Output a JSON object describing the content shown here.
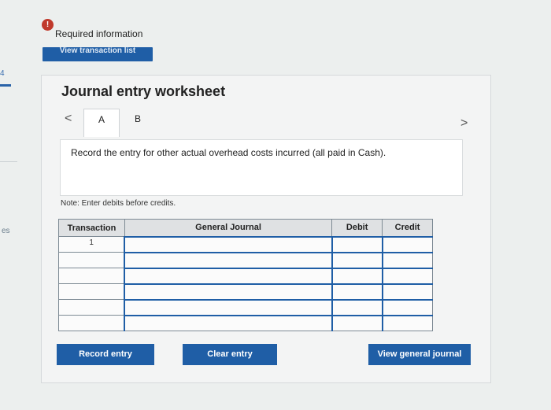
{
  "edge": {
    "number": "4",
    "text": "es"
  },
  "header": {
    "alert_glyph": "!",
    "required_info": "Required information",
    "view_transaction_list": "View transaction list"
  },
  "worksheet": {
    "title": "Journal entry worksheet",
    "nav_prev": "<",
    "nav_next": ">",
    "tabs": [
      {
        "label": "A",
        "active": true
      },
      {
        "label": "B",
        "active": false
      }
    ],
    "instruction": "Record the entry for other actual overhead costs incurred (all paid in Cash).",
    "note": "Note: Enter debits before credits."
  },
  "table": {
    "headers": {
      "transaction": "Transaction",
      "general_journal": "General Journal",
      "debit": "Debit",
      "credit": "Credit"
    },
    "rows": [
      {
        "transaction": "1",
        "general_journal": "",
        "debit": "",
        "credit": ""
      },
      {
        "transaction": "",
        "general_journal": "",
        "debit": "",
        "credit": ""
      },
      {
        "transaction": "",
        "general_journal": "",
        "debit": "",
        "credit": ""
      },
      {
        "transaction": "",
        "general_journal": "",
        "debit": "",
        "credit": ""
      },
      {
        "transaction": "",
        "general_journal": "",
        "debit": "",
        "credit": ""
      },
      {
        "transaction": "",
        "general_journal": "",
        "debit": "",
        "credit": ""
      }
    ]
  },
  "buttons": {
    "record": "Record entry",
    "clear": "Clear entry",
    "view": "View general journal"
  },
  "colors": {
    "accent": "#1f5ea6",
    "alert": "#c0392b",
    "header_bg": "#dfe1e3"
  },
  "icons": {
    "alert": "exclamation-circle-icon",
    "prev": "chevron-left-icon",
    "next": "chevron-right-icon"
  }
}
